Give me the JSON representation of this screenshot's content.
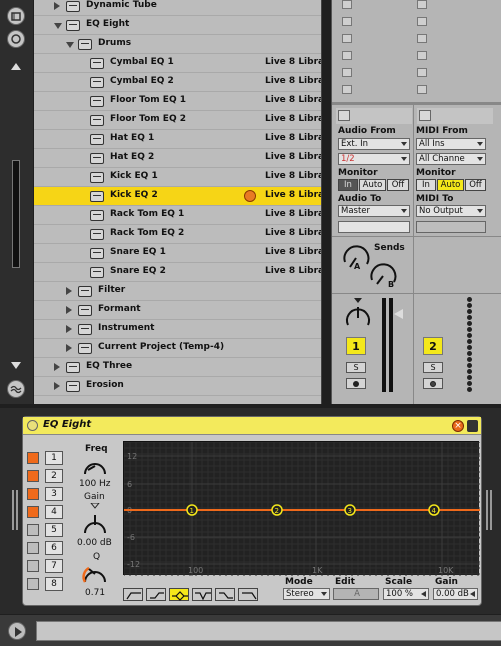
{
  "browser": {
    "rows": [
      {
        "label": "Dynamic Tube",
        "lib": "",
        "level": 1,
        "toggle": "right",
        "icon": "folder"
      },
      {
        "label": "EQ Eight",
        "lib": "",
        "level": 1,
        "toggle": "down",
        "icon": "folder"
      },
      {
        "label": "Drums",
        "lib": "",
        "level": 2,
        "toggle": "down",
        "icon": "folder-open"
      },
      {
        "label": "Cymbal EQ 1",
        "lib": "Live 8 Libra",
        "level": 3,
        "icon": "preset"
      },
      {
        "label": "Cymbal EQ 2",
        "lib": "Live 8 Libra",
        "level": 3,
        "icon": "preset"
      },
      {
        "label": "Floor Tom EQ 1",
        "lib": "Live 8 Libra",
        "level": 3,
        "icon": "preset"
      },
      {
        "label": "Floor Tom EQ 2",
        "lib": "Live 8 Libra",
        "level": 3,
        "icon": "preset"
      },
      {
        "label": "Hat EQ 1",
        "lib": "Live 8 Libra",
        "level": 3,
        "icon": "preset"
      },
      {
        "label": "Hat EQ 2",
        "lib": "Live 8 Libra",
        "level": 3,
        "icon": "preset"
      },
      {
        "label": "Kick EQ 1",
        "lib": "Live 8 Libra",
        "level": 3,
        "icon": "preset"
      },
      {
        "label": "Kick EQ 2",
        "lib": "Live 8 Libra",
        "level": 3,
        "icon": "preset",
        "selected": true
      },
      {
        "label": "Rack Tom EQ 1",
        "lib": "Live 8 Libra",
        "level": 3,
        "icon": "preset"
      },
      {
        "label": "Rack Tom EQ 2",
        "lib": "Live 8 Libra",
        "level": 3,
        "icon": "preset"
      },
      {
        "label": "Snare EQ 1",
        "lib": "Live 8 Libra",
        "level": 3,
        "icon": "preset"
      },
      {
        "label": "Snare EQ 2",
        "lib": "Live 8 Libra",
        "level": 3,
        "icon": "preset"
      },
      {
        "label": "Filter",
        "lib": "",
        "level": 2,
        "toggle": "right",
        "icon": "folder"
      },
      {
        "label": "Formant",
        "lib": "",
        "level": 2,
        "toggle": "right",
        "icon": "folder"
      },
      {
        "label": "Instrument",
        "lib": "",
        "level": 2,
        "toggle": "right",
        "icon": "folder"
      },
      {
        "label": "Current Project (Temp-4)",
        "lib": "",
        "level": 2,
        "toggle": "right",
        "icon": "project"
      },
      {
        "label": "EQ Three",
        "lib": "",
        "level": 1,
        "toggle": "right",
        "icon": "folder"
      },
      {
        "label": "Erosion",
        "lib": "",
        "level": 1,
        "toggle": "right",
        "icon": "folder"
      }
    ]
  },
  "mixer": {
    "left": {
      "audio_from_label": "Audio From",
      "audio_from_value": "Ext. In",
      "input_channel": "1/2",
      "monitor_label": "Monitor",
      "monitor_in": "In",
      "monitor_auto": "Auto",
      "monitor_off": "Off",
      "monitor_active": "In",
      "audio_to_label": "Audio To",
      "audio_to_value": "Master",
      "sends_label": "Sends",
      "send_a": "A",
      "send_b": "B",
      "track_number": "1",
      "solo": "S"
    },
    "right": {
      "midi_from_label": "MIDI From",
      "midi_from_value": "All Ins",
      "input_channel": "All Channe",
      "monitor_label": "Monitor",
      "monitor_in": "In",
      "monitor_auto": "Auto",
      "monitor_off": "Off",
      "monitor_active": "Auto",
      "midi_to_label": "MIDI To",
      "midi_to_value": "No Output",
      "track_number": "2",
      "solo": "S"
    }
  },
  "device": {
    "title": "EQ Eight",
    "bands": [
      {
        "num": "1",
        "on": true
      },
      {
        "num": "2",
        "on": true
      },
      {
        "num": "3",
        "on": true
      },
      {
        "num": "4",
        "on": true
      },
      {
        "num": "5",
        "on": false
      },
      {
        "num": "6",
        "on": false
      },
      {
        "num": "7",
        "on": false
      },
      {
        "num": "8",
        "on": false
      }
    ],
    "freq_label": "Freq",
    "freq_value": "100 Hz",
    "gain_label": "Gain",
    "gain_value": "0.00 dB",
    "q_label": "Q",
    "q_value": "0.71",
    "plot": {
      "y_ticks": [
        "12",
        "6",
        "0",
        "-6",
        "-12"
      ],
      "x_ticks": [
        "100",
        "1K",
        "10K"
      ],
      "band_markers": [
        "1",
        "2",
        "3",
        "4"
      ]
    },
    "mode_label": "Mode",
    "mode_value": "Stereo",
    "edit_label": "Edit",
    "edit_value": "A",
    "scale_label": "Scale",
    "scale_value": "100 %",
    "out_gain_label": "Gain",
    "out_gain_value": "0.00 dB",
    "filter_types": [
      "low-cut-48",
      "low-shelf",
      "bell",
      "notch",
      "high-shelf",
      "high-cut"
    ],
    "active_filter_type": "bell"
  }
}
